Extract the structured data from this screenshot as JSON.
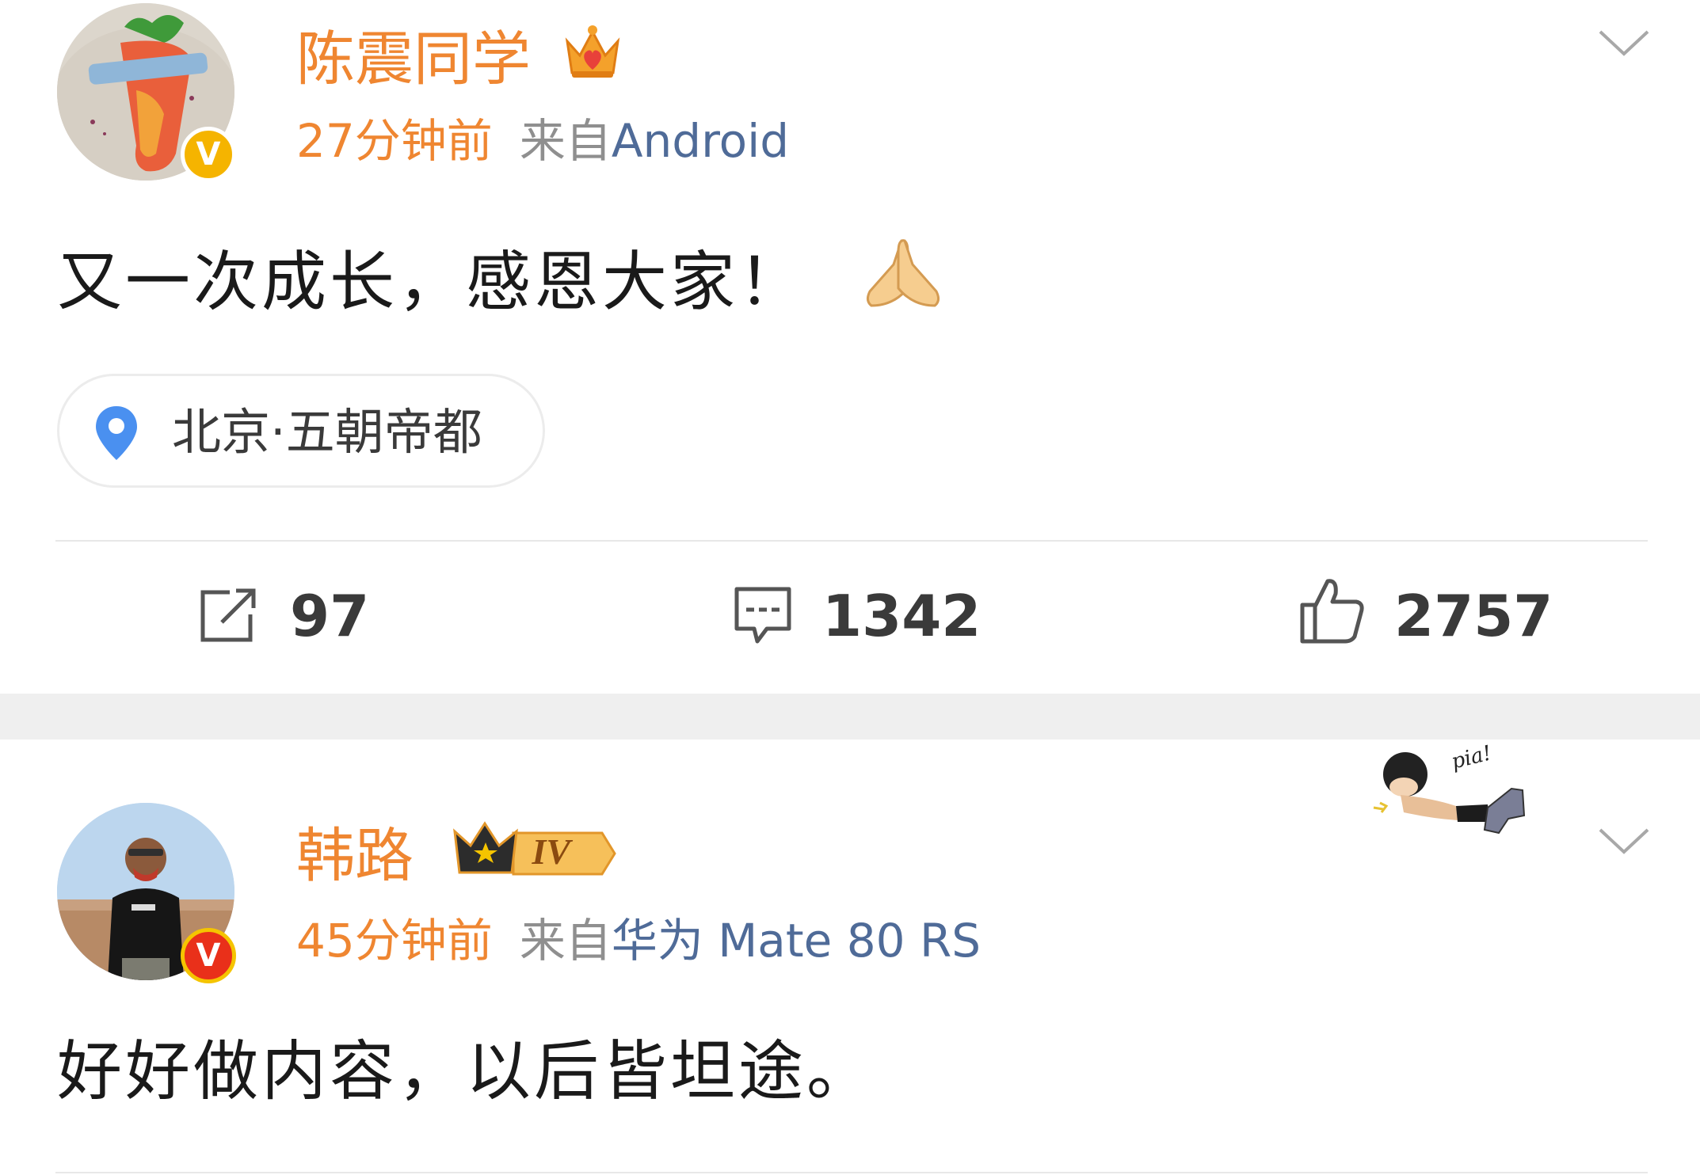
{
  "colors": {
    "username": "#ef8631",
    "timestamp": "#ef8631",
    "source_prefix": "#8f8f8f",
    "device": "#4f6b98",
    "text": "#1a1a1a",
    "location_pin": "#4a90f0",
    "verified_yellow": "#f5b400",
    "verified_red": "#e9301a",
    "separator": "#efefef"
  },
  "posts": [
    {
      "username": "陈震同学",
      "badge_icon": "gold-crown-heart-icon",
      "verified": "yellow-v",
      "verified_letter": "V",
      "time": "27分钟前",
      "source_prefix": "来自",
      "device": "Android",
      "text": "又一次成长，感恩大家！",
      "emoji": "praying-hands-icon",
      "location": "北京·五朝帝都",
      "actions": {
        "repost": "97",
        "comment": "1342",
        "like": "2757"
      }
    },
    {
      "username": "韩路",
      "badge_icon": "crown-level-iv-icon",
      "badge_level": "IV",
      "verified": "red-v",
      "verified_letter": "V",
      "time": "45分钟前",
      "source_prefix": "来自",
      "device": "华为 Mate 80 RS",
      "text": "好好做内容，以后皆坦途。",
      "sticker": "pia-cartoon-sticker",
      "sticker_text": "pia!"
    }
  ]
}
